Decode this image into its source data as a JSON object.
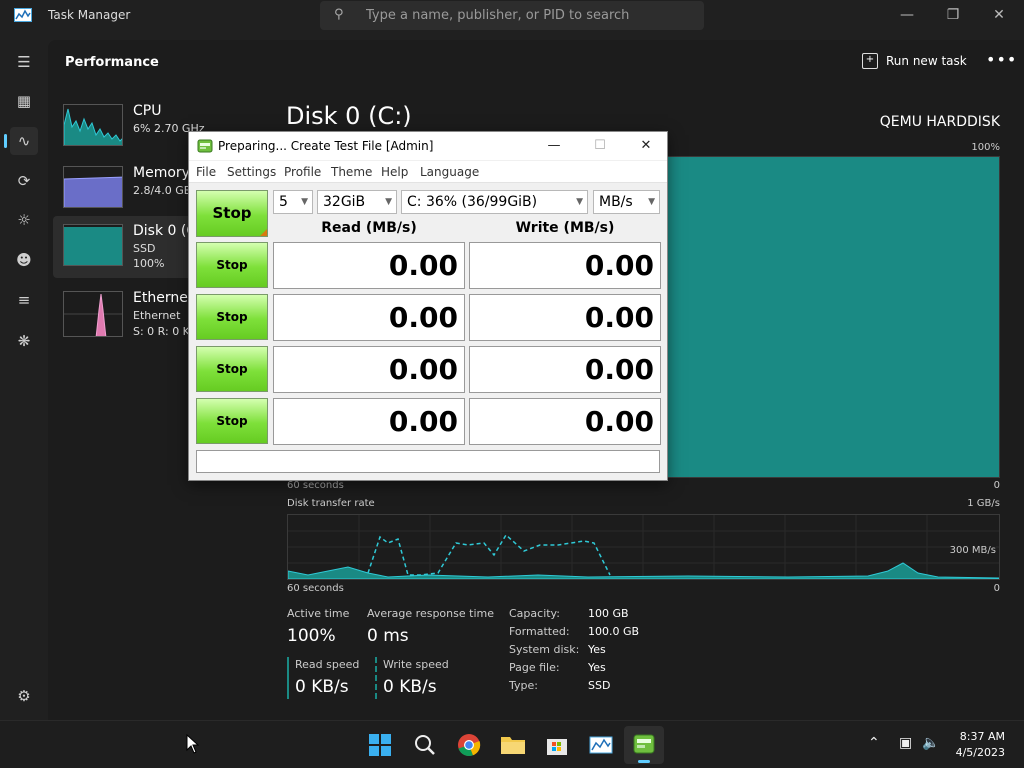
{
  "window": {
    "title": "Task Manager"
  },
  "search": {
    "placeholder": "Type a name, publisher, or PID to search"
  },
  "header": {
    "title": "Performance",
    "run_task": "Run new task"
  },
  "resources": [
    {
      "name": "CPU",
      "line2": "6% 2.70 GHz",
      "line3": ""
    },
    {
      "name": "Memory",
      "line2": "2.8/4.0 GB",
      "line3": ""
    },
    {
      "name": "Disk 0 (C:)",
      "line2": "SSD",
      "line3": "100%"
    },
    {
      "name": "Ethernet",
      "line2": "Ethernet",
      "line3": "S: 0 R: 0 K"
    }
  ],
  "disk": {
    "title": "Disk 0 (C:)",
    "model": "QEMU HARDDISK",
    "pct_max": "100%",
    "axis_time": "60 seconds",
    "zero": "0",
    "transfer_label": "Disk transfer rate",
    "transfer_max": "1 GB/s",
    "transfer_mid": "300 MB/s",
    "active_time_label": "Active time",
    "active_time": "100%",
    "avg_response_label": "Average response time",
    "avg_response": "0 ms",
    "read_speed_label": "Read speed",
    "read_speed": "0 KB/s",
    "write_speed_label": "Write speed",
    "write_speed": "0 KB/s",
    "props": [
      {
        "k": "Capacity:",
        "v": "100 GB"
      },
      {
        "k": "Formatted:",
        "v": "100.0 GB"
      },
      {
        "k": "System disk:",
        "v": "Yes"
      },
      {
        "k": "Page file:",
        "v": "Yes"
      },
      {
        "k": "Type:",
        "v": "SSD"
      }
    ]
  },
  "dialog": {
    "title": "Preparing... Create Test File [Admin]",
    "menu": [
      "File",
      "Settings",
      "Profile",
      "Theme",
      "Help",
      "Language"
    ],
    "all_label": "Stop",
    "count": "5",
    "size": "32GiB",
    "drive": "C: 36% (36/99GiB)",
    "unit": "MB/s",
    "read_header": "Read (MB/s)",
    "write_header": "Write (MB/s)",
    "rows": [
      {
        "label": "Stop",
        "read": "0.00",
        "write": "0.00"
      },
      {
        "label": "Stop",
        "read": "0.00",
        "write": "0.00"
      },
      {
        "label": "Stop",
        "read": "0.00",
        "write": "0.00"
      },
      {
        "label": "Stop",
        "read": "0.00",
        "write": "0.00"
      }
    ]
  },
  "taskbar": {
    "time": "8:37 AM",
    "date": "4/5/2023"
  },
  "icons": {
    "menu": "hamburger-icon",
    "search": "search-icon",
    "settings": "gear-icon"
  },
  "colors": {
    "disk": "#1a8a84",
    "accent": "#60cdff",
    "stop_button": "#7ee03a"
  }
}
